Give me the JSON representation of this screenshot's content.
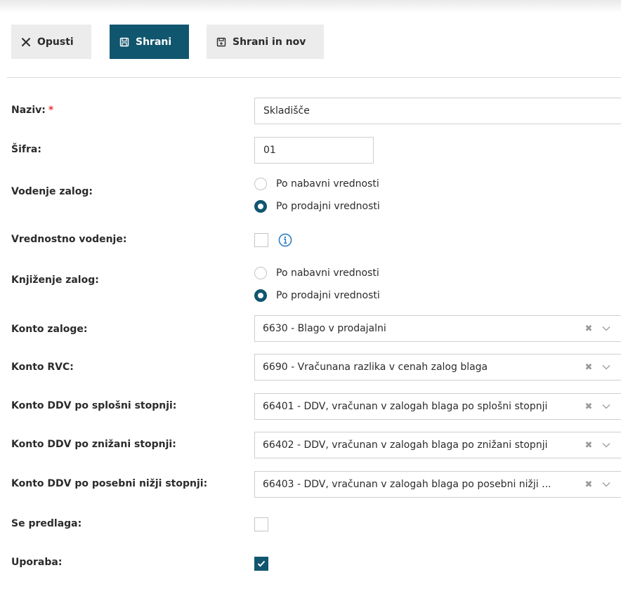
{
  "toolbar": {
    "cancel_label": "Opusti",
    "save_label": "Shrani",
    "save_new_label": "Shrani in nov"
  },
  "form": {
    "naziv": {
      "label": "Naziv:",
      "required_mark": "*",
      "value": "Skladišče"
    },
    "sifra": {
      "label": "Šifra:",
      "value": "01"
    },
    "vodenje_zalog": {
      "label": "Vodenje zalog:",
      "options": [
        "Po nabavni vrednosti",
        "Po prodajni vrednosti"
      ],
      "selected": "Po prodajni vrednosti"
    },
    "vrednostno_vodenje": {
      "label": "Vrednostno vodenje:",
      "checked": false
    },
    "knjizenje_zalog": {
      "label": "Knjiženje zalog:",
      "options": [
        "Po nabavni vrednosti",
        "Po prodajni vrednosti"
      ],
      "selected": "Po prodajni vrednosti"
    },
    "konto_zaloge": {
      "label": "Konto zaloge:",
      "value": "6630 - Blago v prodajalni"
    },
    "konto_rvc": {
      "label": "Konto RVC:",
      "value": "6690 - Vračunana razlika v cenah zalog blaga"
    },
    "konto_ddv_splosni": {
      "label": "Konto DDV po splošni stopnji:",
      "value": "66401 - DDV, vračunan v zalogah blaga po splošni stopnji"
    },
    "konto_ddv_znizani": {
      "label": "Konto DDV po znižani stopnji:",
      "value": "66402 - DDV, vračunan v zalogah blaga po znižani stopnji"
    },
    "konto_ddv_posebni": {
      "label": "Konto DDV po posebni nižji stopnji:",
      "value": "66403 - DDV, vračunan v zalogah blaga po posebni nižji ..."
    },
    "se_predlaga": {
      "label": "Se predlaga:",
      "checked": false
    },
    "uporaba": {
      "label": "Uporaba:",
      "checked": true
    }
  },
  "colors": {
    "primary": "#11566f",
    "required": "#e03a3a",
    "info_icon": "#2f7fc1"
  },
  "icons": {
    "cancel": "close-icon",
    "save": "save-icon",
    "save_new": "save-new-icon",
    "info": "info-icon",
    "clear": "clear-icon",
    "dropdown": "chevron-down-icon"
  }
}
